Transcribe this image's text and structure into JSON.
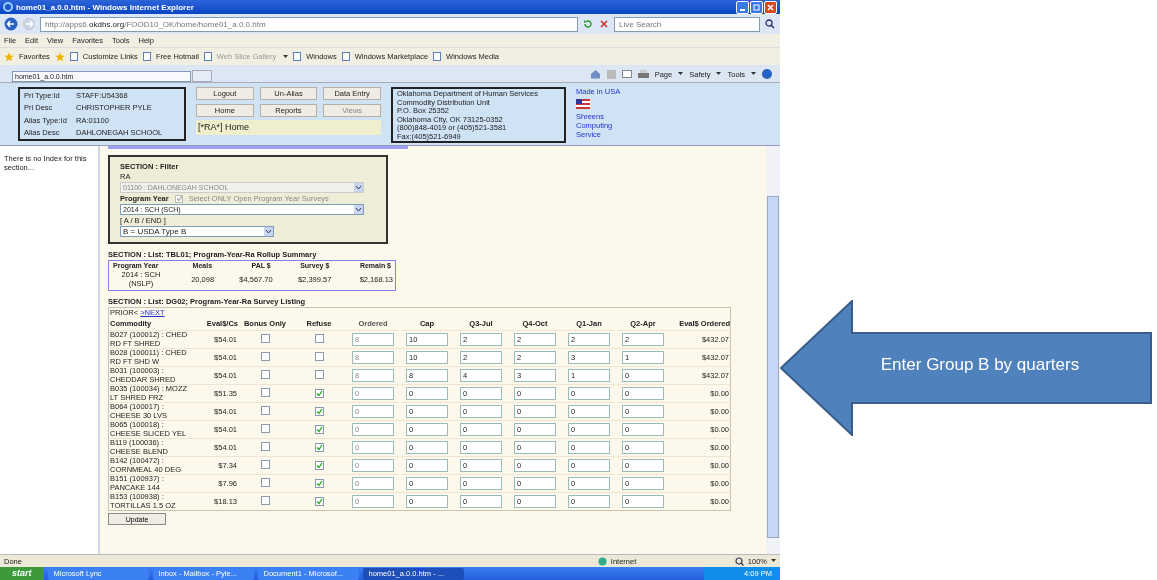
{
  "window": {
    "title": "home01_a.0.0.htm - Windows Internet Explorer"
  },
  "address_bar": {
    "prefix": "http://apps6.",
    "domain": "okdhs.org",
    "path": "/FOOD10_OK/home/home01_a.0.0.htm"
  },
  "search": {
    "placeholder": "Live Search"
  },
  "menu": [
    "File",
    "Edit",
    "View",
    "Favorites",
    "Tools",
    "Help"
  ],
  "favorites_bar": {
    "label": "Favorites",
    "links": [
      {
        "label": "Customize Links",
        "disabled": false,
        "dropdown": false
      },
      {
        "label": "Free Hotmail",
        "disabled": false,
        "dropdown": false
      },
      {
        "label": "Web Slice Gallery",
        "disabled": true,
        "dropdown": true
      },
      {
        "label": "Windows",
        "disabled": false,
        "dropdown": false
      },
      {
        "label": "Windows Marketplace",
        "disabled": false,
        "dropdown": false
      },
      {
        "label": "Windows Media",
        "disabled": false,
        "dropdown": false
      }
    ]
  },
  "tabs": [
    {
      "label": "home01_a.0.0.htm",
      "selected": true
    }
  ],
  "command_bar": [
    "Page",
    "Safety",
    "Tools"
  ],
  "header": {
    "info": [
      {
        "label": "Pri Type:Id",
        "value": "STAFF:U54368"
      },
      {
        "label": "Pri Desc",
        "value": "CHRISTOPHER PYLE"
      },
      {
        "label": "Alias Type:Id",
        "value": "RA:01100"
      },
      {
        "label": "Alias Desc",
        "value": "DAHLONEGAH SCHOOL"
      }
    ],
    "buttons": [
      {
        "label": "Logout",
        "disabled": false
      },
      {
        "label": "Un-Alias",
        "disabled": false
      },
      {
        "label": "Data Entry",
        "disabled": false
      },
      {
        "label": "Home",
        "disabled": false
      },
      {
        "label": "Reports",
        "disabled": false
      },
      {
        "label": "Views",
        "disabled": true
      }
    ],
    "breadcrumb": "[*RA*] Home",
    "agency": [
      "Oklahoma Department of Human Services",
      "Commodity Distribution Unit",
      "P.O. Box 25352",
      "Oklahoma City, OK 73125-0352",
      "(800)848-4019 or (405)521-3581",
      "Fax:(405)521-6949"
    ],
    "made_in": "Made in USA",
    "service": [
      "Shreens",
      "Computing",
      "Service"
    ]
  },
  "sidebar": {
    "text": "There is no Index for this section..."
  },
  "filter": {
    "title": "SECTION : Filter",
    "ra_label": "RA",
    "ra_value": "01100 : DAHLONEGAH SCHOOL",
    "ra_disabled": true,
    "year_label": "Program Year",
    "open_only": {
      "label": "Select ONLY Open Program Year Surveys",
      "checked": true,
      "disabled": true
    },
    "year_value": "2014 : SCH (SCH)",
    "type_label": "[ A / B / END ]",
    "type_value": "B = USDA Type B"
  },
  "summary": {
    "title": "SECTION : List:  TBL01;    Program-Year-Ra Rollup Summary",
    "columns": [
      "Program Year",
      "Meals",
      "PAL $",
      "Survey $",
      "Remain $"
    ],
    "rows": [
      [
        "2014 : SCH (NSLP)",
        "20,098",
        "$4,567.70",
        "$2,399.57",
        "$2,168.13"
      ]
    ]
  },
  "listing": {
    "title": "SECTION : List:  DG02;    Program-Year-Ra Survey Listing",
    "prior": "PRIOR<",
    "next": ">NEXT",
    "columns": [
      "Commodity",
      "Eval$/Cs",
      "Bonus Only",
      "Refuse",
      "Ordered",
      "Cap",
      "Q3-Jul",
      "Q4-Oct",
      "Q1-Jan",
      "Q2-Apr",
      "Eval$ Ordered"
    ],
    "rows": [
      {
        "commodity": "B027 (100012) : CHED RD FT SHRED",
        "eval": "$54.01",
        "bonus_only": false,
        "refuse": false,
        "ordered": "8",
        "ordered_disabled": true,
        "cap": "10",
        "q3": "2",
        "q4": "2",
        "q1": "2",
        "q2": "2",
        "eval_ordered": "$432.07"
      },
      {
        "commodity": "B028 (100011) : CHED RD FT SHD W",
        "eval": "$54.01",
        "bonus_only": false,
        "refuse": false,
        "ordered": "8",
        "ordered_disabled": true,
        "cap": "10",
        "q3": "2",
        "q4": "2",
        "q1": "3",
        "q2": "1",
        "eval_ordered": "$432.07"
      },
      {
        "commodity": "B031 (100003) : CHEDDAR SHRED",
        "eval": "$54.01",
        "bonus_only": false,
        "refuse": false,
        "ordered": "8",
        "ordered_disabled": true,
        "cap": "8",
        "q3": "4",
        "q4": "3",
        "q1": "1",
        "q2": "0",
        "eval_ordered": "$432.07"
      },
      {
        "commodity": "B035 (100034) : MOZZ LT SHRED FRZ",
        "eval": "$51.35",
        "bonus_only": false,
        "refuse": true,
        "ordered": "0",
        "ordered_disabled": true,
        "cap": "0",
        "q3": "0",
        "q4": "0",
        "q1": "0",
        "q2": "0",
        "eval_ordered": "$0.00"
      },
      {
        "commodity": "B064 (100017) : CHEESE 30 LVS",
        "eval": "$54.01",
        "bonus_only": false,
        "refuse": true,
        "ordered": "0",
        "ordered_disabled": true,
        "cap": "0",
        "q3": "0",
        "q4": "0",
        "q1": "0",
        "q2": "0",
        "eval_ordered": "$0.00"
      },
      {
        "commodity": "B065 (100018) : CHEESE SLICED YEL",
        "eval": "$54.01",
        "bonus_only": false,
        "refuse": true,
        "ordered": "0",
        "ordered_disabled": true,
        "cap": "0",
        "q3": "0",
        "q4": "0",
        "q1": "0",
        "q2": "0",
        "eval_ordered": "$0.00"
      },
      {
        "commodity": "B119 (100036) : CHEESE BLEND",
        "eval": "$54.01",
        "bonus_only": false,
        "refuse": true,
        "ordered": "0",
        "ordered_disabled": true,
        "cap": "0",
        "q3": "0",
        "q4": "0",
        "q1": "0",
        "q2": "0",
        "eval_ordered": "$0.00"
      },
      {
        "commodity": "B142 (100472) : CORNMEAL 40 DEG",
        "eval": "$7.34",
        "bonus_only": false,
        "refuse": true,
        "ordered": "0",
        "ordered_disabled": true,
        "cap": "0",
        "q3": "0",
        "q4": "0",
        "q1": "0",
        "q2": "0",
        "eval_ordered": "$0.00"
      },
      {
        "commodity": "B151 (100937) : PANCAKE 144",
        "eval": "$7.96",
        "bonus_only": false,
        "refuse": true,
        "ordered": "0",
        "ordered_disabled": true,
        "cap": "0",
        "q3": "0",
        "q4": "0",
        "q1": "0",
        "q2": "0",
        "eval_ordered": "$0.00"
      },
      {
        "commodity": "B153 (100938) : TORTILLAS 1.5 OZ",
        "eval": "$18.13",
        "bonus_only": false,
        "refuse": true,
        "ordered": "0",
        "ordered_disabled": true,
        "cap": "0",
        "q3": "0",
        "q4": "0",
        "q1": "0",
        "q2": "0",
        "eval_ordered": "$0.00"
      }
    ],
    "update_button": "Update"
  },
  "status_bar": {
    "text": "Done",
    "zone": "Internet",
    "zoom": "100%"
  },
  "taskbar": {
    "start": "start",
    "items": [
      {
        "label": "Microsoft Lync",
        "selected": false
      },
      {
        "label": "Inbox - Mailbox - Pyle...",
        "selected": false
      },
      {
        "label": "Document1 - Microsof...",
        "selected": false
      },
      {
        "label": "home01_a.0.0.htm - ...",
        "selected": true
      }
    ],
    "clock": "4:09 PM"
  },
  "callout": {
    "text": "Enter Group B by quarters"
  }
}
